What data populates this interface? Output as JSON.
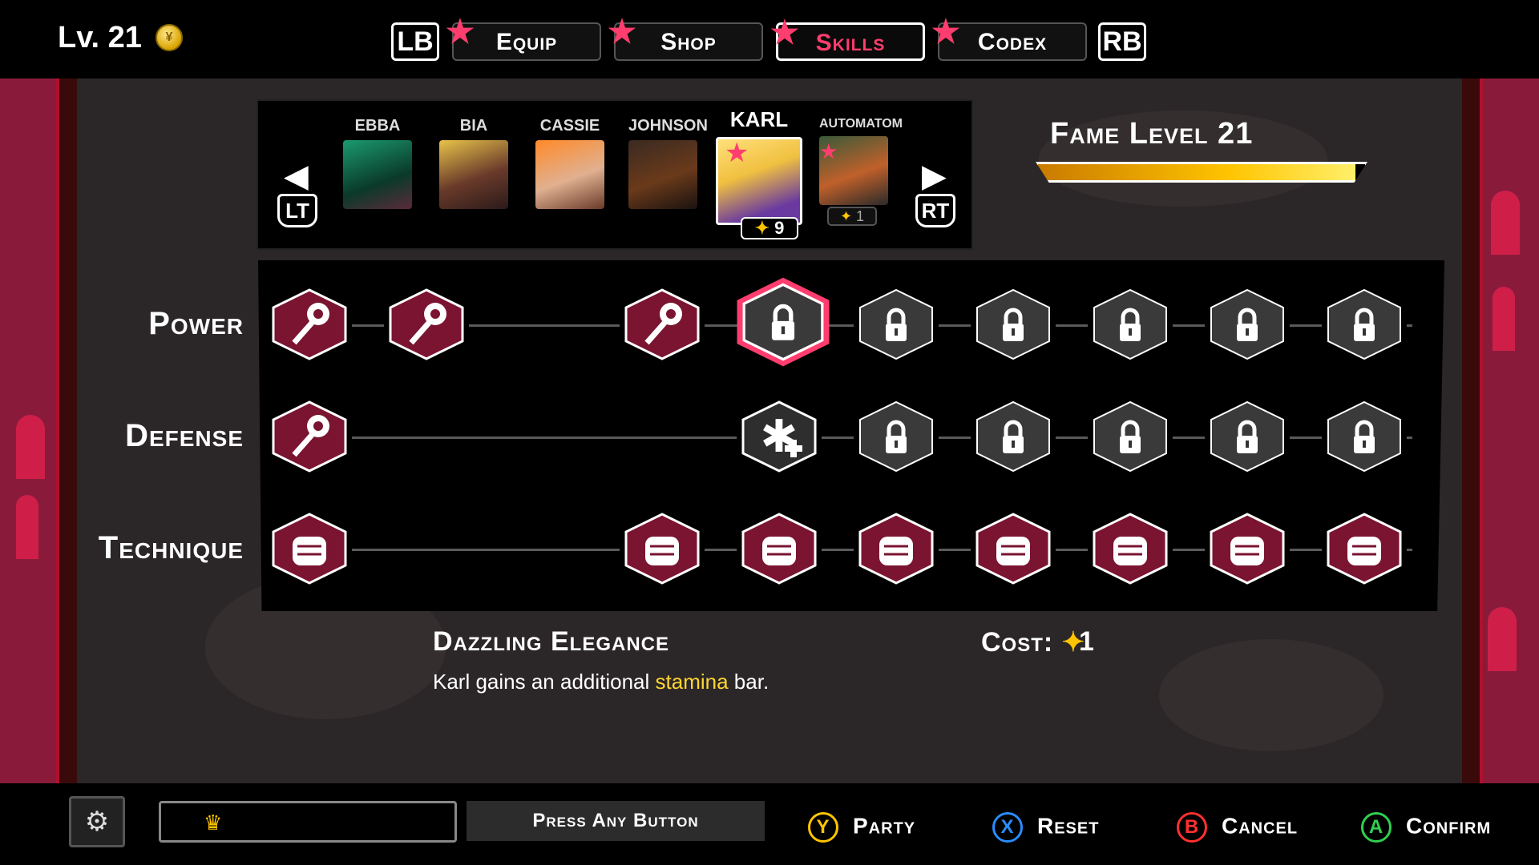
{
  "header": {
    "level": "Lv. 21",
    "lb": "LB",
    "rb": "RB",
    "tabs": [
      {
        "label": "Equip",
        "active": false
      },
      {
        "label": "Shop",
        "active": false
      },
      {
        "label": "Skills",
        "active": true
      },
      {
        "label": "Codex",
        "active": false
      }
    ]
  },
  "characters": {
    "lt": "LT",
    "rt": "RT",
    "list": [
      {
        "name": "EBBA"
      },
      {
        "name": "BIA"
      },
      {
        "name": "CASSIE"
      },
      {
        "name": "JOHNSON"
      },
      {
        "name": "KARL",
        "selected": true,
        "points": "9"
      },
      {
        "name": "AUTOMATOM",
        "points": "1"
      }
    ]
  },
  "fame": {
    "title": "Fame Level 21",
    "progress": 0.97
  },
  "skills": {
    "rows": [
      {
        "label": "Power"
      },
      {
        "label": "Defense"
      },
      {
        "label": "Technique"
      }
    ],
    "selected": {
      "name": "Dazzling Elegance",
      "desc_pre": "Karl gains an additional ",
      "desc_highlight": "stamina",
      "desc_post": " bar.",
      "cost_label": "Cost:",
      "cost_value": "1"
    }
  },
  "footer": {
    "press_any": "Press Any Button",
    "party": {
      "key": "Y",
      "label": "Party"
    },
    "reset": {
      "key": "X",
      "label": "Reset"
    },
    "cancel": {
      "key": "B",
      "label": "Cancel"
    },
    "confirm": {
      "key": "A",
      "label": "Confirm"
    }
  },
  "colors": {
    "accent": "#ff3d6e",
    "owned": "#7a1430",
    "locked": "#3a3a3a",
    "gold": "#ffc400"
  }
}
